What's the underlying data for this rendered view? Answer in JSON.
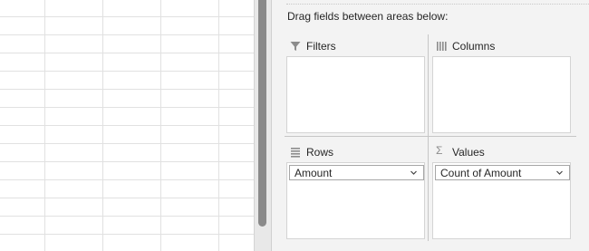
{
  "pane": {
    "instruction": "Drag fields between areas below:"
  },
  "areas": {
    "filters": {
      "label": "Filters",
      "icon": "filter-icon"
    },
    "columns": {
      "label": "Columns",
      "icon": "columns-icon"
    },
    "rows": {
      "label": "Rows",
      "icon": "rows-icon",
      "fields": [
        "Amount"
      ]
    },
    "values": {
      "label": "Values",
      "icon": "sigma-icon",
      "symbol": "Σ",
      "fields": [
        "Count of Amount"
      ]
    }
  },
  "colors": {
    "pane_bg": "#f3f3f3",
    "grid_line": "#e1e1e1",
    "splitter_thumb": "#8a8a8a",
    "text": "#262626"
  }
}
